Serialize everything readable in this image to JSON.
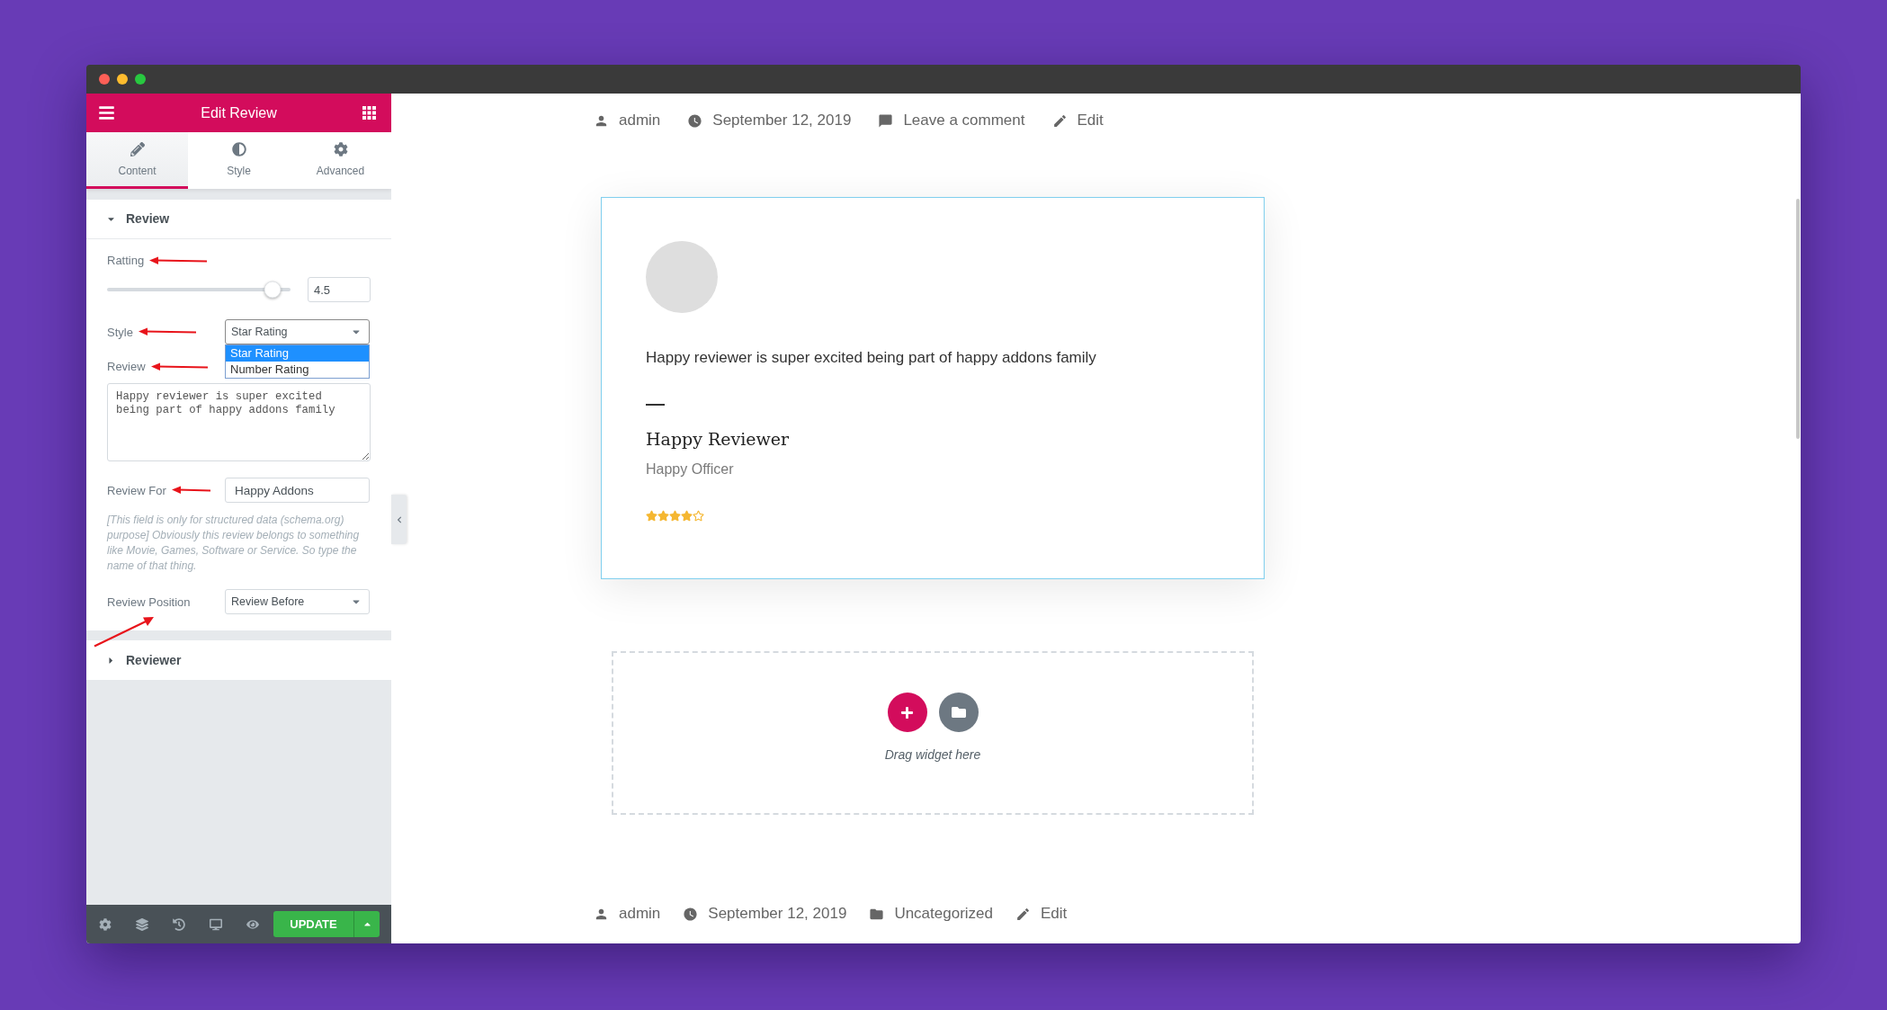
{
  "panel": {
    "title": "Edit Review",
    "tabs": [
      {
        "label": "Content",
        "selected": true
      },
      {
        "label": "Style",
        "selected": false
      },
      {
        "label": "Advanced",
        "selected": false
      }
    ],
    "sections": [
      {
        "title": "Review",
        "expanded": true,
        "controls": [
          {
            "kind": "slider",
            "label": "Ratting",
            "level": 0.9,
            "value": "4.5"
          },
          {
            "kind": "select",
            "label": "Style",
            "value": "Star Rating",
            "expanded": true,
            "options": [
              {
                "label": "Star Rating",
                "selected": true
              },
              {
                "label": "Number Rating",
                "selected": false
              }
            ]
          },
          {
            "kind": "textarea",
            "label": "Review",
            "value": "Happy reviewer is super excited being part of happy addons family"
          },
          {
            "kind": "text",
            "label": "Review For",
            "value": "Happy Addons",
            "help": "[This field is only for structured data (schema.org) purpose] Obviously this review belongs to something like Movie, Games, Software or Service. So type the name of that thing."
          },
          {
            "kind": "select",
            "label": "Review Position",
            "value": "Review Before",
            "expanded": false
          }
        ]
      },
      {
        "title": "Reviewer",
        "expanded": false
      }
    ],
    "update_button": "UPDATE"
  },
  "post": {
    "top_meta": [
      {
        "kind": "author",
        "text": "admin"
      },
      {
        "kind": "date",
        "text": "September 12, 2019"
      },
      {
        "kind": "comments",
        "text": "Leave a comment"
      },
      {
        "kind": "edit",
        "text": "Edit"
      }
    ],
    "review_card": {
      "text": "Happy reviewer is super excited being part of happy addons family",
      "name": "Happy Reviewer",
      "title": "Happy Officer",
      "stars": 4
    },
    "drop_zone": {
      "hint": "Drag widget here"
    },
    "bottom_meta": [
      {
        "kind": "author",
        "text": "admin"
      },
      {
        "kind": "date",
        "text": "September 12, 2019"
      },
      {
        "kind": "category",
        "text": "Uncategorized"
      },
      {
        "kind": "edit",
        "text": "Edit"
      }
    ]
  }
}
